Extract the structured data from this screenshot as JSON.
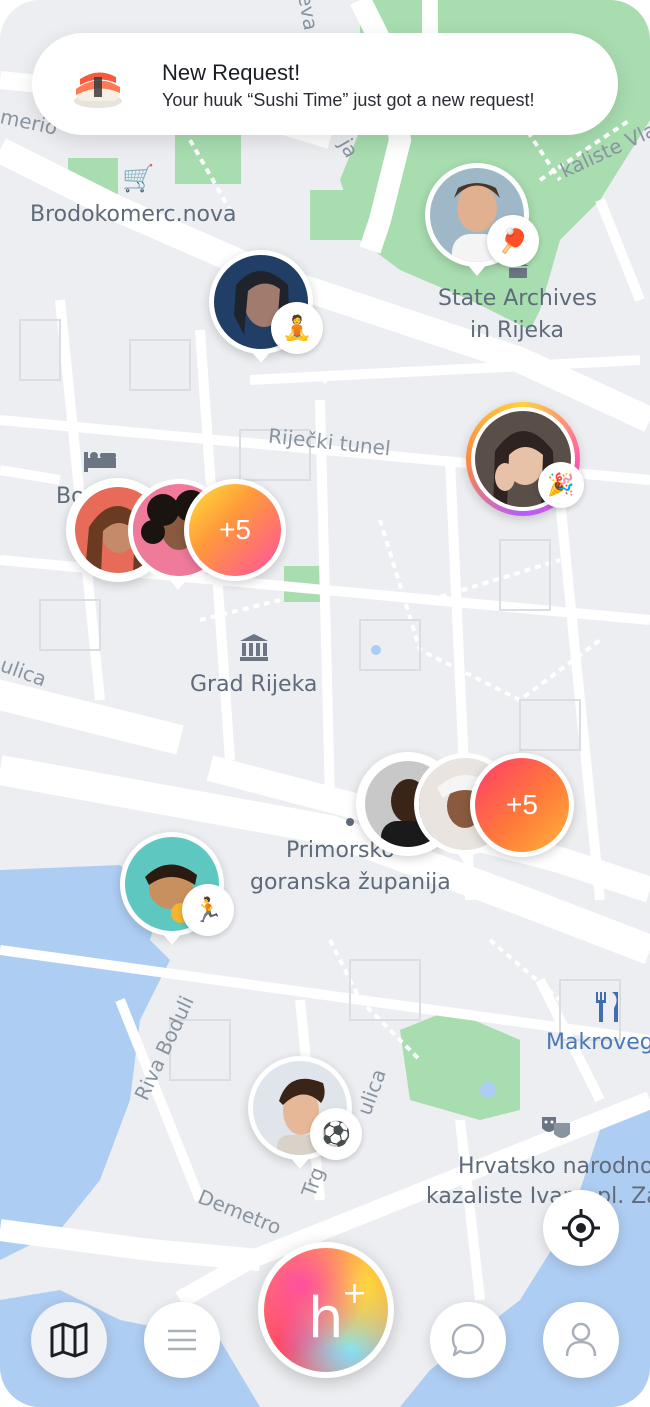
{
  "notification": {
    "title": "New Request!",
    "message": "Your huuk “Sushi Time” just got a new request!",
    "thumb_icon": "sushi-icon"
  },
  "map": {
    "place_labels": {
      "brodokomerc": "Brodokomerc.nova",
      "state_archives_line1": "State Archives",
      "state_archives_line2": "in Rijeka",
      "rijecki_tunel": "Riječki tunel",
      "bo": "Bo",
      "grad_rijeka": "Grad Rijeka",
      "primorsko_line1": "Primorsko-",
      "primorsko_line2": "goranska županija",
      "makroveg": "Makroveg",
      "hnk_line1": "Hrvatsko narodno",
      "hnk_line2": "kazaliste Ivana pl. Za",
      "merio": "merio",
      "eva": "eva",
      "ja": "ja",
      "kaliste": "kaliste Vladim",
      "ulica_left": "ulica",
      "riva_boduli": "Riva Boduli",
      "ulica_right": "ulica",
      "trg": "Trg",
      "demetro": "Demetro"
    },
    "colors": {
      "water": "#aecdf2",
      "park": "#a8ddb0",
      "road": "#ffffff",
      "land": "#eceef1"
    }
  },
  "pins": [
    {
      "name": "pin-ping-pong",
      "activity_icon": "ping-pong-icon",
      "activity": "🏓"
    },
    {
      "name": "pin-meditation",
      "activity_icon": "meditation-icon",
      "activity": "🧘"
    },
    {
      "name": "pin-party",
      "activity_icon": "party-popper-icon",
      "activity": "🎉"
    },
    {
      "name": "pin-running",
      "activity_icon": "running-icon",
      "activity": "🏃"
    },
    {
      "name": "pin-soccer",
      "activity_icon": "soccer-ball-icon",
      "activity": "⚽"
    }
  ],
  "clusters": [
    {
      "name": "cluster-west",
      "count_label": "+5"
    },
    {
      "name": "cluster-east",
      "count_label": "+5"
    }
  ],
  "nav": {
    "map_icon": "map-icon",
    "list_icon": "list-icon",
    "create_label": "h",
    "create_plus": "+",
    "chat_icon": "chat-bubble-icon",
    "profile_icon": "profile-icon",
    "locate_icon": "crosshair-icon"
  }
}
